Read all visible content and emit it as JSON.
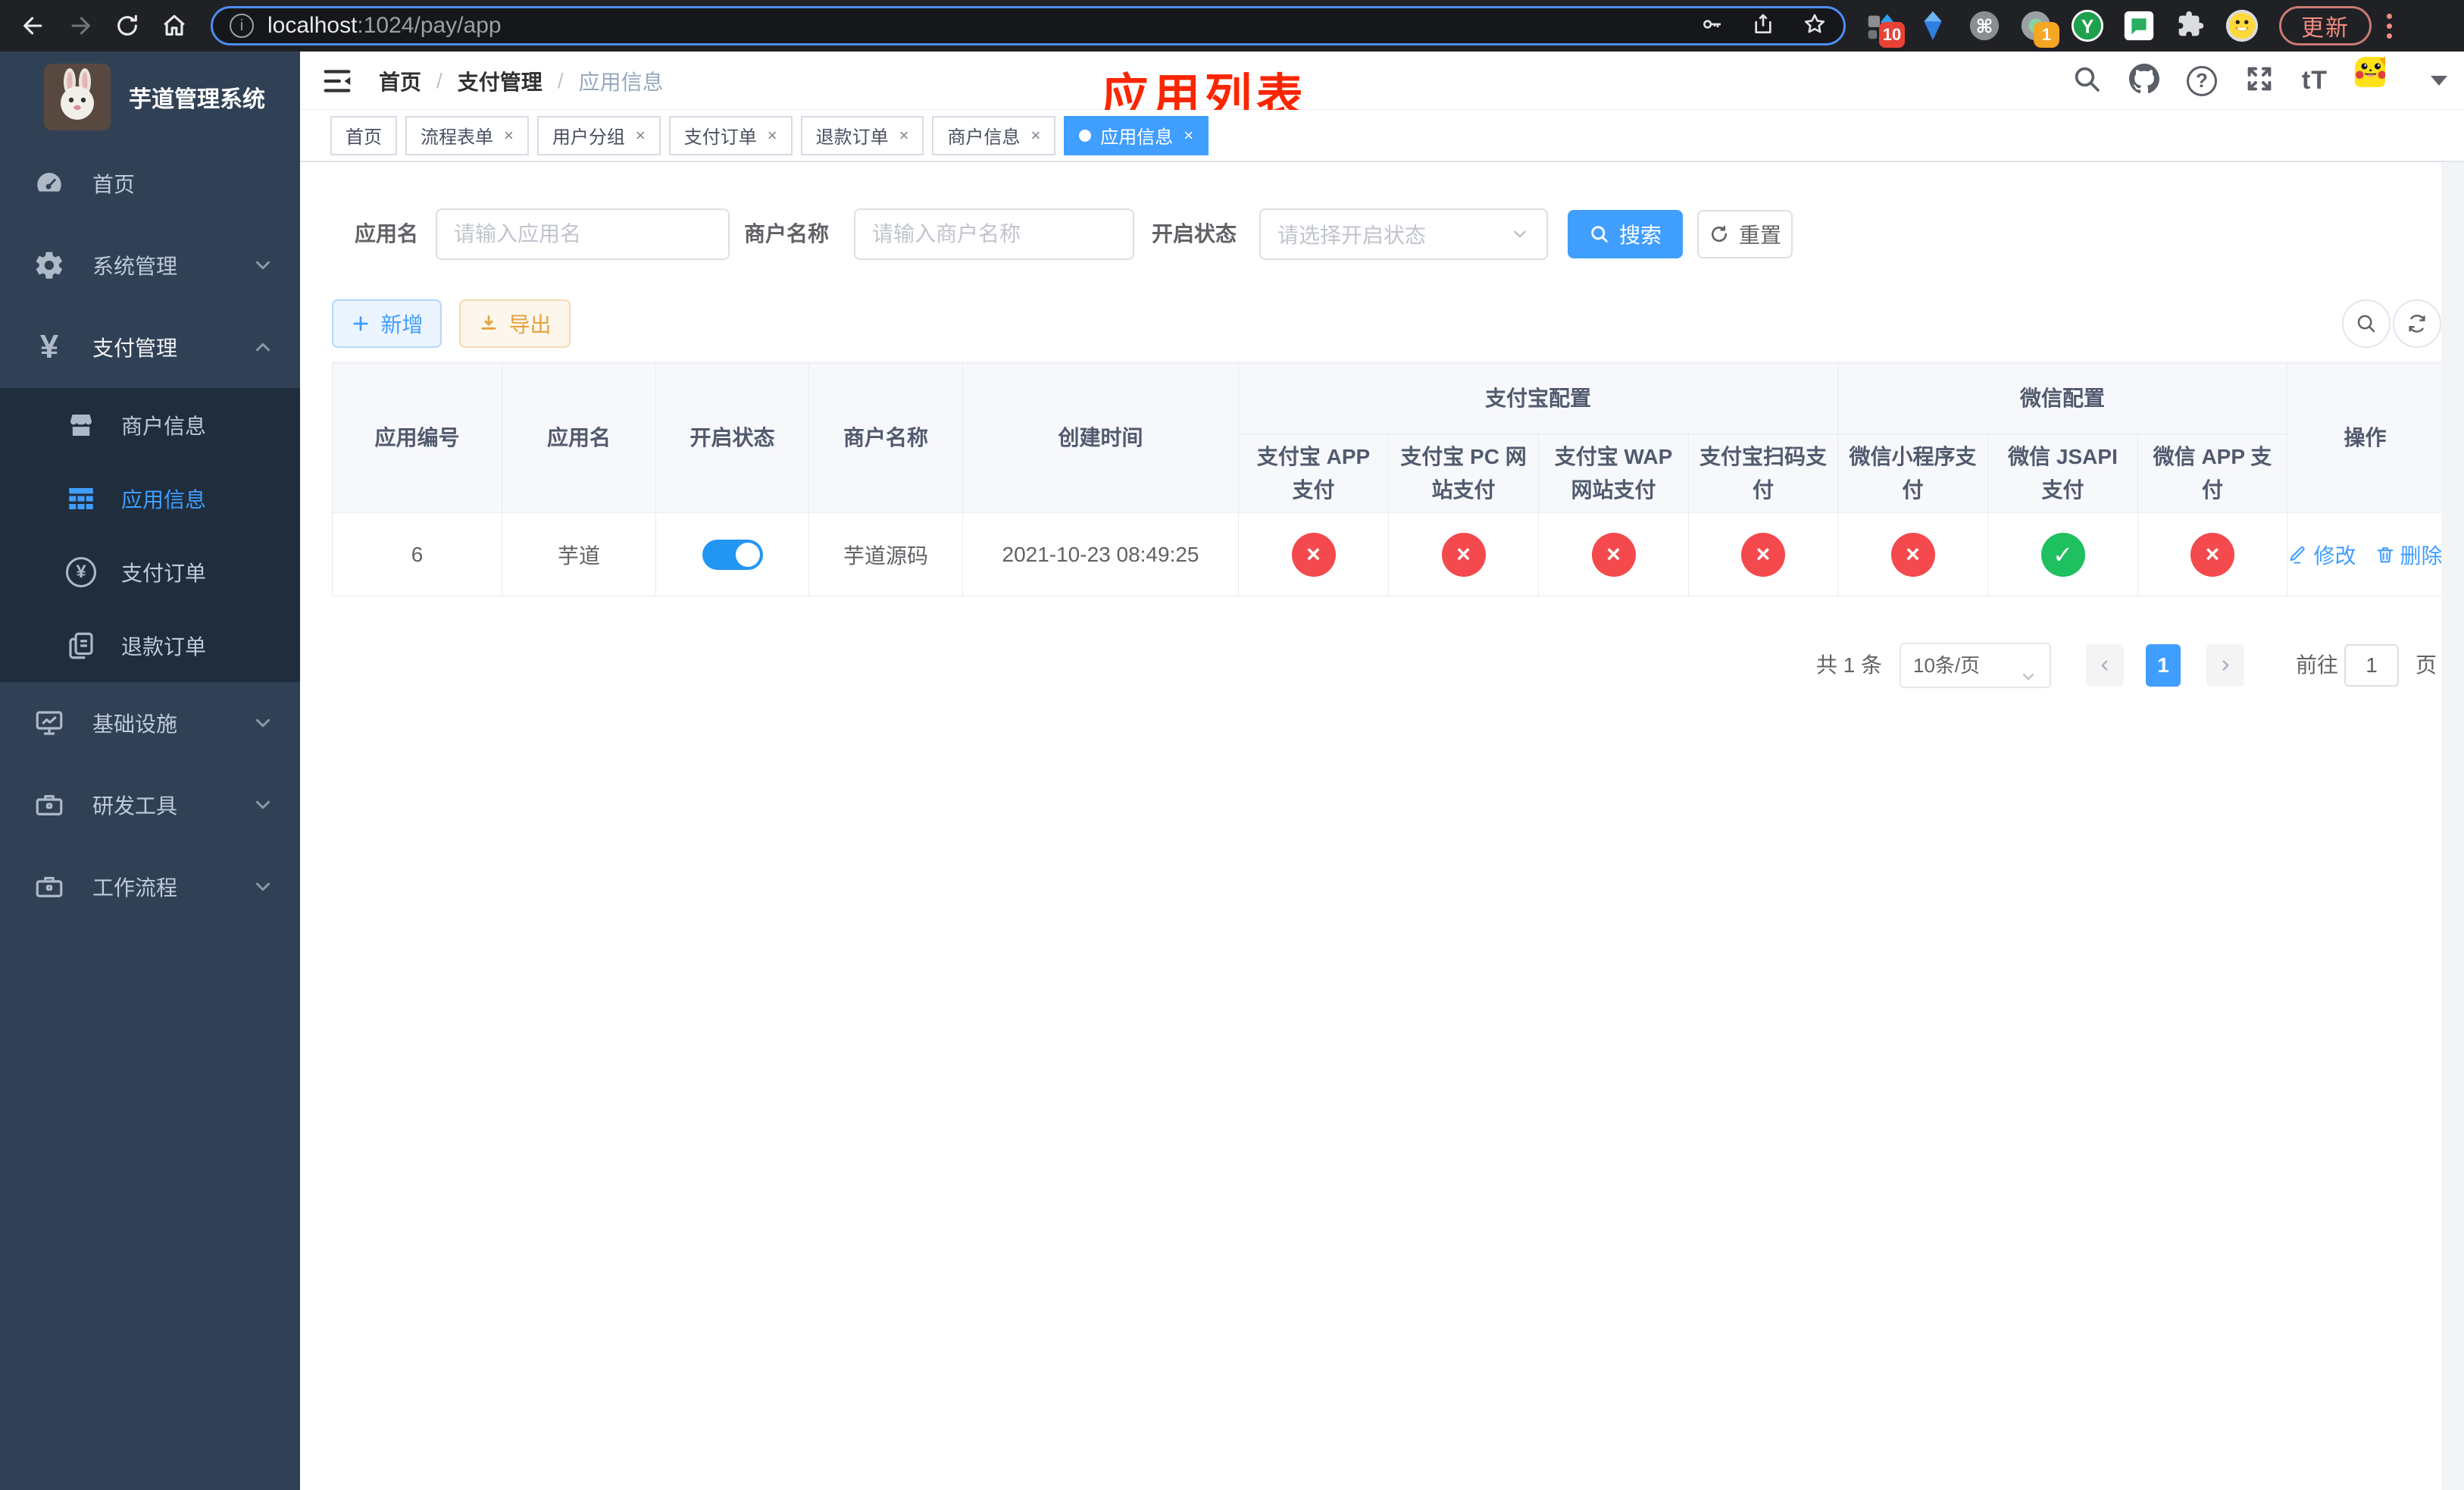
{
  "browser": {
    "url_host": "localhost",
    "url_path": ":1024/pay/app",
    "update_label": "更新",
    "pinned_ext_badge": "10",
    "profile_ext_badge": "1"
  },
  "sidebar": {
    "logo_title": "芋道管理系统",
    "items": {
      "home": "首页",
      "system": "系统管理",
      "payment": "支付管理",
      "merchant": "商户信息",
      "app_info": "应用信息",
      "pay_order": "支付订单",
      "refund_order": "退款订单",
      "infra": "基础设施",
      "dev_tools": "研发工具",
      "workflow": "工作流程"
    }
  },
  "header": {
    "breadcrumb": [
      "首页",
      "支付管理",
      "应用信息"
    ],
    "annotation": "应用列表"
  },
  "tags": [
    {
      "label": "首页",
      "closable": false,
      "active": false
    },
    {
      "label": "流程表单",
      "closable": true,
      "active": false
    },
    {
      "label": "用户分组",
      "closable": true,
      "active": false
    },
    {
      "label": "支付订单",
      "closable": true,
      "active": false
    },
    {
      "label": "退款订单",
      "closable": true,
      "active": false
    },
    {
      "label": "商户信息",
      "closable": true,
      "active": false
    },
    {
      "label": "应用信息",
      "closable": true,
      "active": true
    }
  ],
  "filters": {
    "app_name_label": "应用名",
    "app_name_placeholder": "请输入应用名",
    "merchant_label": "商户名称",
    "merchant_placeholder": "请输入商户名称",
    "status_label": "开启状态",
    "status_placeholder": "请选择开启状态",
    "search_label": "搜索",
    "reset_label": "重置"
  },
  "toolbar": {
    "add_label": "新增",
    "export_label": "导出"
  },
  "table": {
    "group_alipay": "支付宝配置",
    "group_wechat": "微信配置",
    "col_app_id": "应用编号",
    "col_app_name": "应用名",
    "col_status": "开启状态",
    "col_merchant": "商户名称",
    "col_create_time": "创建时间",
    "channel_columns": [
      "支付宝 APP 支付",
      "支付宝 PC 网站支付",
      "支付宝 WAP 网站支付",
      "支付宝扫码支付",
      "微信小程序支付",
      "微信 JSAPI 支付",
      "微信 APP 支付"
    ],
    "col_actions": "操作",
    "rows": [
      {
        "app_id": "6",
        "app_name": "芋道",
        "enabled": true,
        "merchant_name": "芋道源码",
        "create_time": "2021-10-23 08:49:25",
        "channel_status": [
          "fail",
          "fail",
          "fail",
          "fail",
          "fail",
          "success",
          "fail"
        ],
        "edit_label": "修改",
        "delete_label": "删除"
      }
    ]
  },
  "pagination": {
    "total": "共 1 条",
    "page_size": "10条/页",
    "page": "1",
    "goto": "前往",
    "goto_value": "1",
    "unit": "页"
  },
  "colors": {
    "accent_blue": "#409eff",
    "success_green": "#1ec05f",
    "danger_red": "#f4494d",
    "warning_orange": "#e6a23c",
    "sidebar_bg": "#304156",
    "submenu_bg": "#1f2d3d",
    "annotation_red": "#fb2600",
    "browser_bg": "#202124"
  }
}
